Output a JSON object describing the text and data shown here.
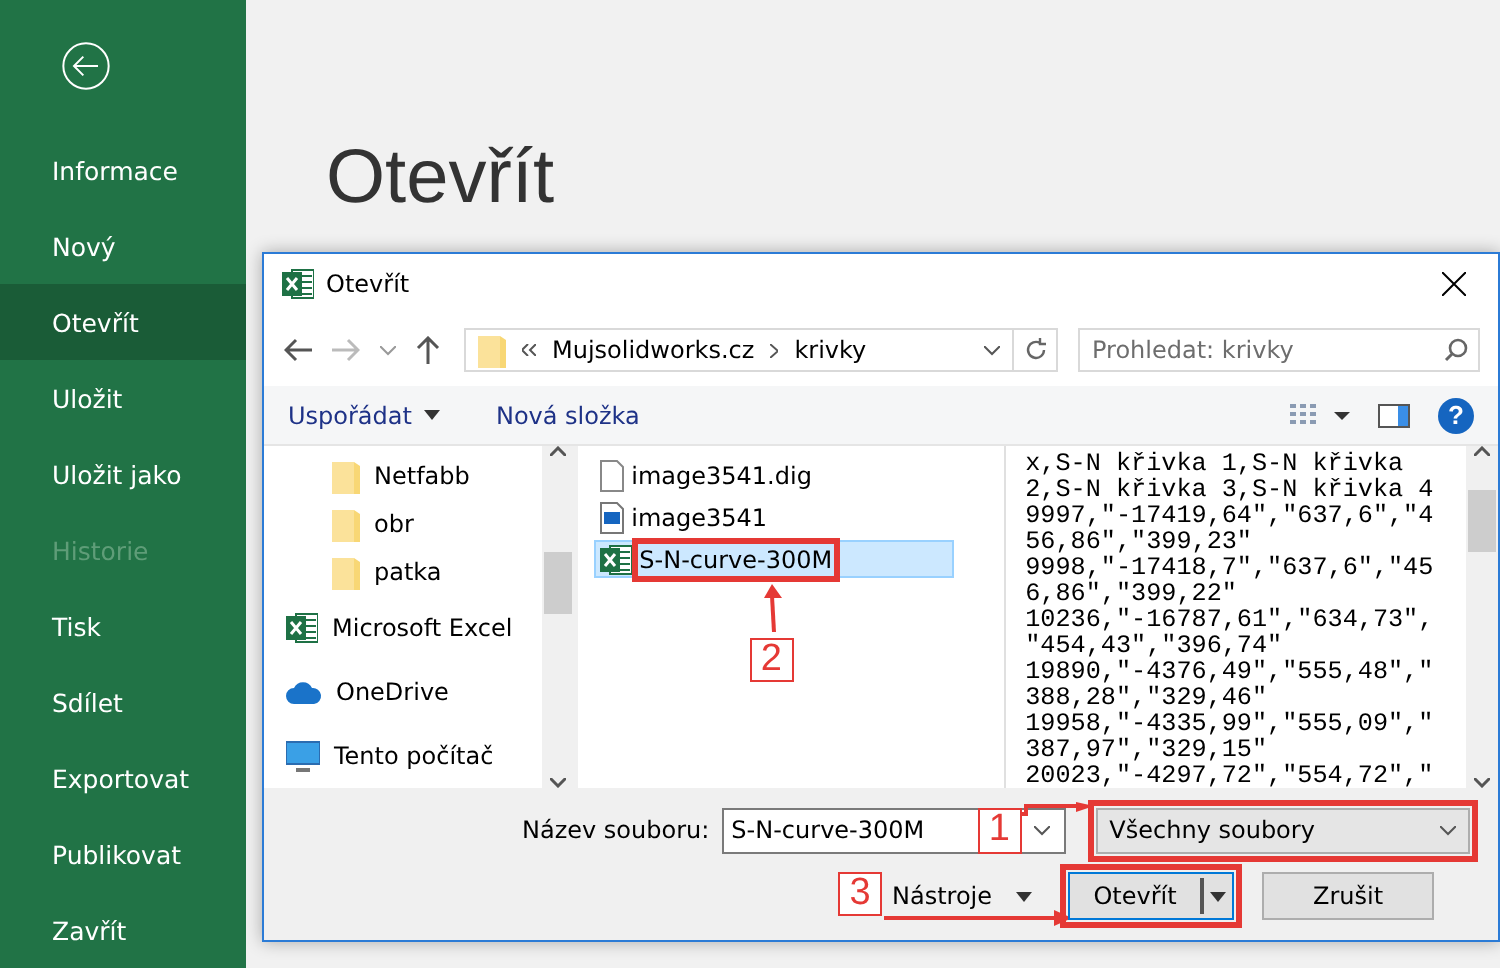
{
  "backstage": {
    "title": "Otevřít",
    "nav": [
      {
        "label": "Informace",
        "selected": false,
        "disabled": false
      },
      {
        "label": "Nový",
        "selected": false,
        "disabled": false
      },
      {
        "label": "Otevřít",
        "selected": true,
        "disabled": false
      },
      {
        "label": "Uložit",
        "selected": false,
        "disabled": false
      },
      {
        "label": "Uložit jako",
        "selected": false,
        "disabled": false
      },
      {
        "label": "Historie",
        "selected": false,
        "disabled": true
      },
      {
        "label": "Tisk",
        "selected": false,
        "disabled": false
      },
      {
        "label": "Sdílet",
        "selected": false,
        "disabled": false
      },
      {
        "label": "Exportovat",
        "selected": false,
        "disabled": false
      },
      {
        "label": "Publikovat",
        "selected": false,
        "disabled": false
      },
      {
        "label": "Zavřít",
        "selected": false,
        "disabled": false
      }
    ]
  },
  "dialog": {
    "title": "Otevřít",
    "address": [
      "Mujsolidworks.cz",
      "krivky"
    ],
    "search": {
      "placeholder": "Prohledat: krivky"
    },
    "toolbar": [
      "Uspořádat",
      "Nová složka"
    ],
    "help_button": "?",
    "tree": [
      {
        "label": "Netfabb",
        "kind": "folder"
      },
      {
        "label": "obr",
        "kind": "folder"
      },
      {
        "label": "patka",
        "kind": "folder"
      },
      {
        "label": "Microsoft Excel",
        "kind": "excel"
      },
      {
        "label": "OneDrive",
        "kind": "cloud"
      },
      {
        "label": "Tento počítač",
        "kind": "computer"
      }
    ],
    "files": [
      {
        "name": "image3541.dig",
        "kind": "file",
        "selected": false
      },
      {
        "name": "image3541",
        "kind": "image",
        "selected": false
      },
      {
        "name": "S-N-curve-300M",
        "kind": "excel",
        "selected": true,
        "callout": "2"
      }
    ],
    "preview": [
      "x,S-N křivka 1,S-N křivka",
      "2,S-N křivka 3,S-N křivka 4",
      "9997,\"-17419,64\",\"637,6\",\"4",
      "56,86\",\"399,23\"",
      "9998,\"-17418,7\",\"637,6\",\"45",
      "6,86\",\"399,22\"",
      "10236,\"-16787,61\",\"634,73\",",
      "\"454,43\",\"396,74\"",
      "19890,\"-4376,49\",\"555,48\",\"",
      "388,28\",\"329,46\"",
      "19958,\"-4335,99\",\"555,09\",\"",
      "387,97\",\"329,15\"",
      "20023,\"-4297,72\",\"554,72\",\""
    ],
    "filename": {
      "label": "Název souboru:",
      "value": "S-N-curve-300M"
    },
    "filter": {
      "value": "Všechny soubory",
      "callout": "1"
    },
    "tools_button": "Nástroje",
    "open_button": {
      "label": "Otevřít",
      "callout": "3"
    },
    "cancel_button": "Zrušit"
  }
}
